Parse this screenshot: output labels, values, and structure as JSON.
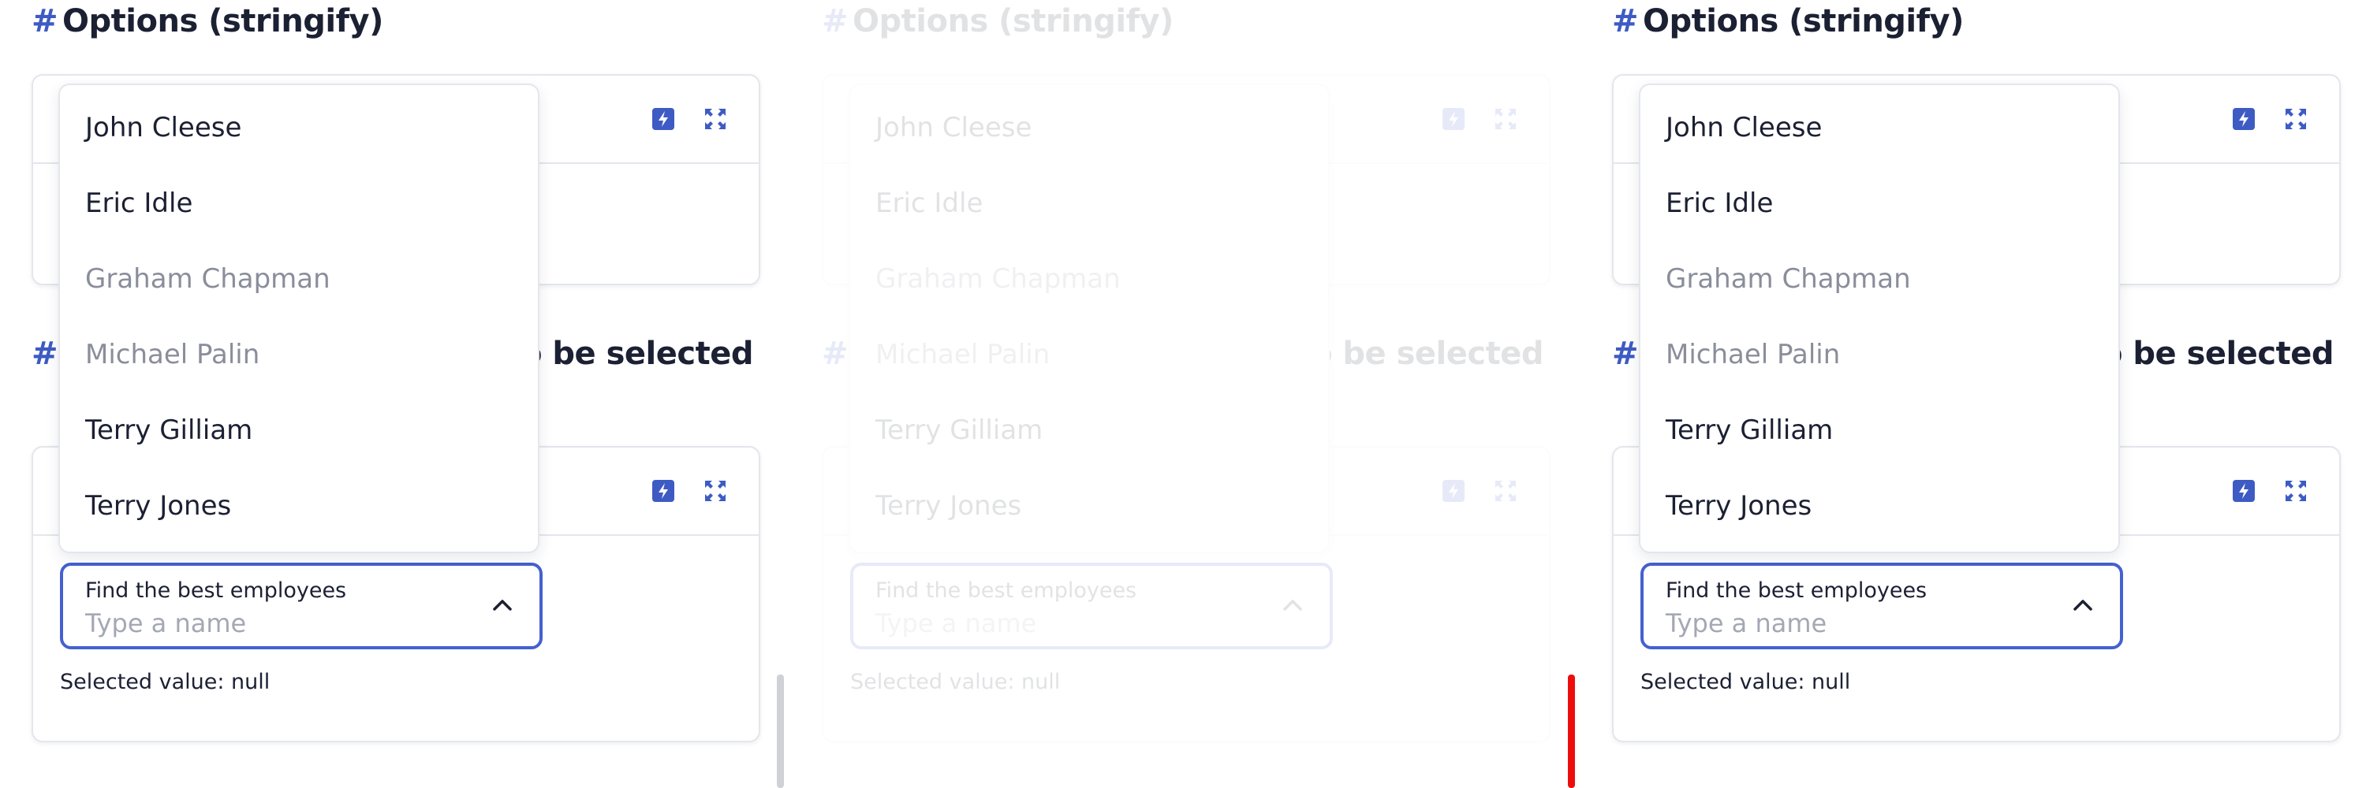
{
  "panels": [
    {
      "section1_title": "Options (stringify)",
      "section2_title": "...o be selected",
      "field_label": "Find the best employees",
      "field_placeholder": "Type a name",
      "selected_value_text": "Selected value: null",
      "options": [
        {
          "label": "John Cleese",
          "disabled": false
        },
        {
          "label": "Eric Idle",
          "disabled": false
        },
        {
          "label": "Graham Chapman",
          "disabled": true
        },
        {
          "label": "Michael Palin",
          "disabled": true
        },
        {
          "label": "Terry Gilliam",
          "disabled": false
        },
        {
          "label": "Terry Jones",
          "disabled": false
        }
      ]
    },
    {
      "section1_title": "Options (stringify)",
      "section2_title": "...o be selected",
      "field_label": "Find the best employees",
      "field_placeholder": "Type a name",
      "selected_value_text": "Selected value: null",
      "options": [
        {
          "label": "John Cleese",
          "disabled": false
        },
        {
          "label": "Eric Idle",
          "disabled": false
        },
        {
          "label": "Graham Chapman",
          "disabled": true
        },
        {
          "label": "Michael Palin",
          "disabled": true
        },
        {
          "label": "Terry Gilliam",
          "disabled": false
        },
        {
          "label": "Terry Jones",
          "disabled": false
        }
      ]
    },
    {
      "section1_title": "Options (stringify)",
      "section2_title": "...o be selected",
      "field_label": "Find the best employees",
      "field_placeholder": "Type a name",
      "selected_value_text": "Selected value: null",
      "options": [
        {
          "label": "John Cleese",
          "disabled": false
        },
        {
          "label": "Eric Idle",
          "disabled": false
        },
        {
          "label": "Graham Chapman",
          "disabled": true
        },
        {
          "label": "Michael Palin",
          "disabled": true
        },
        {
          "label": "Terry Gilliam",
          "disabled": false
        },
        {
          "label": "Terry Jones",
          "disabled": false
        }
      ]
    }
  ],
  "hash_symbol": "#",
  "icons": {
    "flash": "flash-icon",
    "expand": "expand-icon",
    "chevron": "chevron-up-icon"
  },
  "colors": {
    "accent": "#4461cf",
    "text": "#1b2033",
    "muted": "#8a8e9b",
    "placeholder": "#a4a8b4",
    "border": "#e4e6ec",
    "scroll_red": "#ee0d0d",
    "scroll_gray": "#cfd1d6"
  }
}
